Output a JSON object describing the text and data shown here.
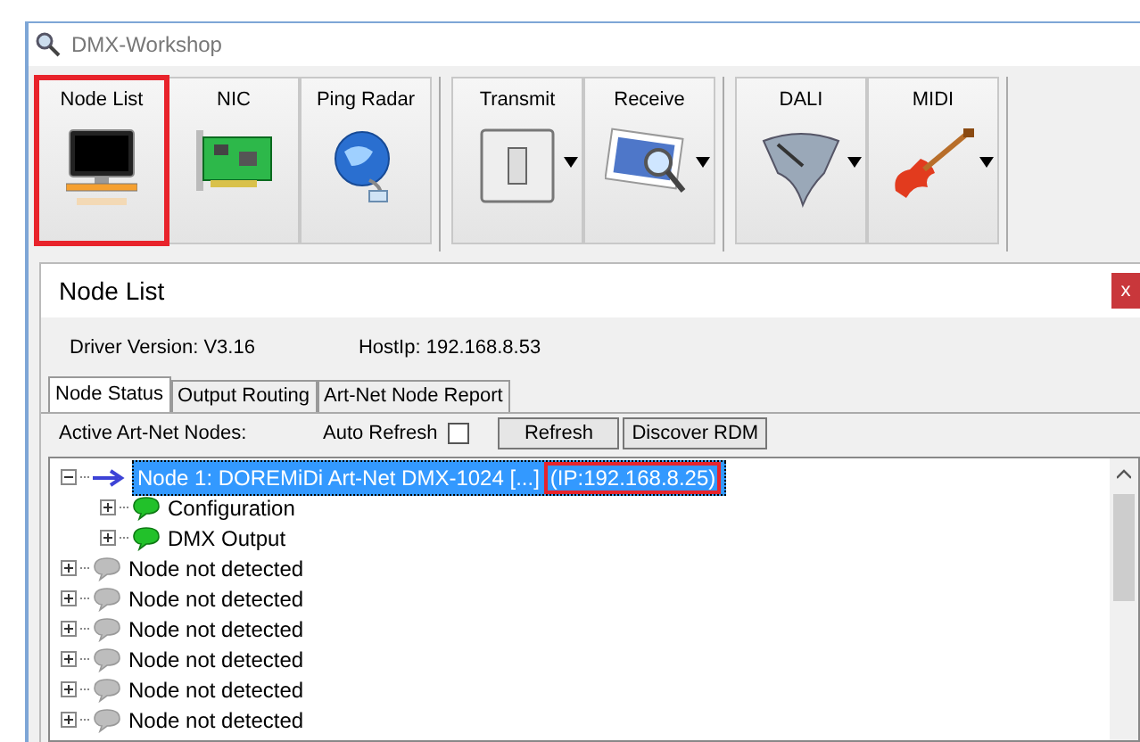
{
  "window": {
    "title": "DMX-Workshop"
  },
  "toolbar": [
    {
      "label": "Node List",
      "dropdown": false,
      "highlighted": true
    },
    {
      "label": "NIC",
      "dropdown": false,
      "highlighted": false
    },
    {
      "label": "Ping Radar",
      "dropdown": false,
      "highlighted": false
    },
    {
      "label": "Transmit",
      "dropdown": true,
      "highlighted": false
    },
    {
      "label": "Receive",
      "dropdown": true,
      "highlighted": false
    },
    {
      "label": "DALI",
      "dropdown": true,
      "highlighted": false
    },
    {
      "label": "MIDI",
      "dropdown": true,
      "highlighted": false
    }
  ],
  "dialog": {
    "title": "Node List",
    "close": "x",
    "driver_version": "Driver Version: V3.16",
    "host_ip": "HostIp: 192.168.8.53",
    "tabs": [
      {
        "label": "Node Status",
        "selected": true
      },
      {
        "label": "Output Routing",
        "selected": false
      },
      {
        "label": "Art-Net Node Report",
        "selected": false
      }
    ],
    "active_label": "Active Art-Net Nodes:",
    "auto_refresh": {
      "label": "Auto Refresh",
      "checked": false
    },
    "buttons": [
      "Refresh",
      "Discover RDM"
    ],
    "tree": [
      {
        "name": "Node 1: DOREMiDi Art-Net DMX-1024 [...]",
        "ip": "(IP:192.168.8.25)",
        "kind": "active",
        "expanded": true,
        "selected": true,
        "highlighted": true,
        "children": [
          {
            "name": "Configuration",
            "kind": "ok",
            "expanded": false,
            "selected": false
          },
          {
            "name": "DMX Output",
            "kind": "ok",
            "expanded": false,
            "selected": false
          }
        ]
      },
      {
        "name": "Node not detected",
        "kind": "missing",
        "expanded": false,
        "selected": false
      },
      {
        "name": "Node not detected",
        "kind": "missing",
        "expanded": false,
        "selected": false
      },
      {
        "name": "Node not detected",
        "kind": "missing",
        "expanded": false,
        "selected": false
      },
      {
        "name": "Node not detected",
        "kind": "missing",
        "expanded": false,
        "selected": false
      },
      {
        "name": "Node not detected",
        "kind": "missing",
        "expanded": false,
        "selected": false
      },
      {
        "name": "Node not detected",
        "kind": "missing",
        "expanded": false,
        "selected": false
      }
    ]
  }
}
